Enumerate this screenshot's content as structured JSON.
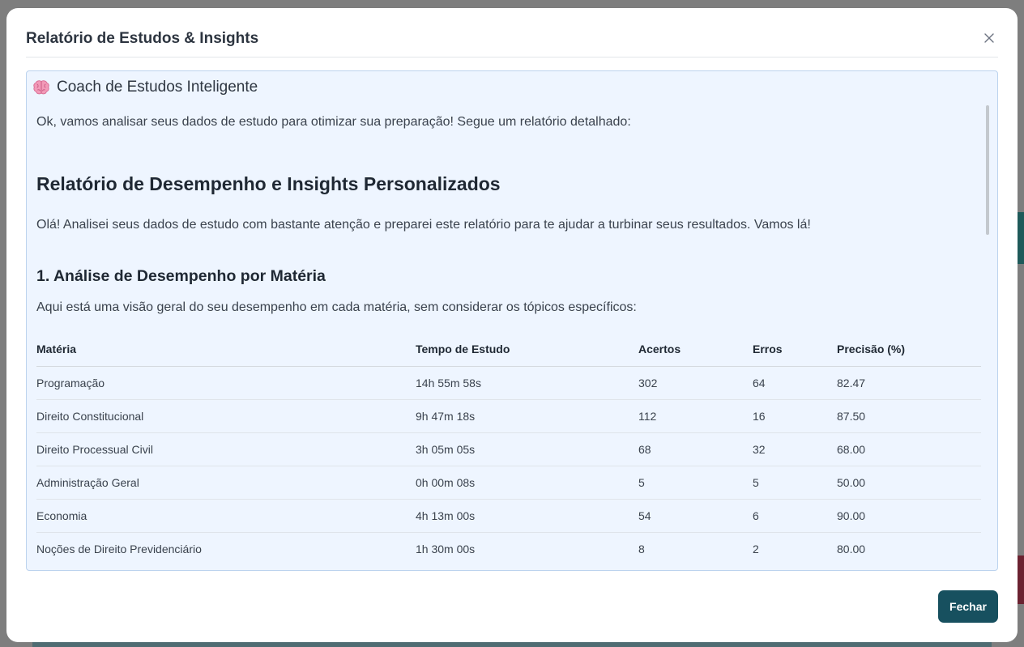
{
  "modal": {
    "title": "Relatório de Estudos & Insights",
    "close_icon": "close-icon",
    "footer_button": "Fechar"
  },
  "panel": {
    "icon": "brain-icon",
    "heading": "Coach de Estudos Inteligente",
    "intro": "Ok, vamos analisar seus dados de estudo para otimizar sua preparação! Segue um relatório detalhado:",
    "report_title": "Relatório de Desempenho e Insights Personalizados",
    "greeting": "Olá! Analisei seus dados de estudo com bastante atenção e preparei este relatório para te ajudar a turbinar seus resultados. Vamos lá!",
    "section_title": "1. Análise de Desempenho por Matéria",
    "section_desc": "Aqui está uma visão geral do seu desempenho em cada matéria, sem considerar os tópicos específicos:"
  },
  "table": {
    "headers": [
      "Matéria",
      "Tempo de Estudo",
      "Acertos",
      "Erros",
      "Precisão (%)"
    ],
    "rows": [
      [
        "Programação",
        "14h 55m 58s",
        "302",
        "64",
        "82.47"
      ],
      [
        "Direito Constitucional",
        "9h 47m 18s",
        "112",
        "16",
        "87.50"
      ],
      [
        "Direito Processual Civil",
        "3h 05m 05s",
        "68",
        "32",
        "68.00"
      ],
      [
        "Administração Geral",
        "0h 00m 08s",
        "5",
        "5",
        "50.00"
      ],
      [
        "Economia",
        "4h 13m 00s",
        "54",
        "6",
        "90.00"
      ],
      [
        "Noções de Direito Previdenciário",
        "1h 30m 00s",
        "8",
        "2",
        "80.00"
      ]
    ]
  },
  "colors": {
    "primary_button": "#17505f",
    "panel_background": "#eef5ff",
    "panel_border": "#bcd3ee"
  }
}
